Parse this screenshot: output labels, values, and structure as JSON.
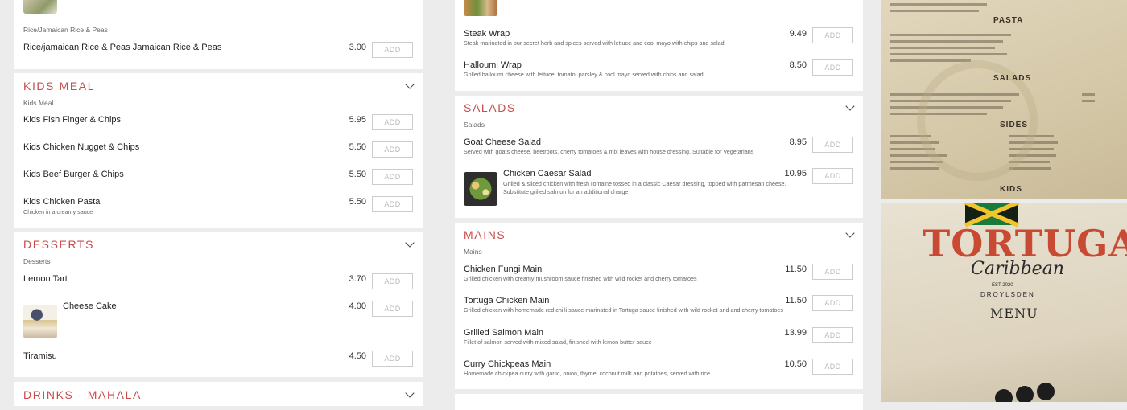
{
  "left": {
    "rice_card": {
      "subtitle": "Rice/Jamaican Rice & Peas",
      "item": {
        "name": "Rice/jamaican Rice & Peas Jamaican Rice & Peas",
        "price": "3.00"
      }
    },
    "kids": {
      "title": "KIDS MEAL",
      "subtitle": "Kids Meal",
      "items": [
        {
          "name": "Kids Fish Finger & Chips",
          "price": "5.95",
          "desc": ""
        },
        {
          "name": "Kids Chicken Nugget & Chips",
          "price": "5.50",
          "desc": ""
        },
        {
          "name": "Kids Beef Burger & Chips",
          "price": "5.50",
          "desc": ""
        },
        {
          "name": "Kids Chicken Pasta",
          "price": "5.50",
          "desc": "Chicken in a creamy sauce"
        }
      ]
    },
    "desserts": {
      "title": "DESSERTS",
      "subtitle": "Desserts",
      "items": [
        {
          "name": "Lemon Tart",
          "price": "3.70"
        },
        {
          "name": "Cheese Cake",
          "price": "4.00"
        },
        {
          "name": "Tiramisu",
          "price": "4.50"
        }
      ]
    },
    "drinks": {
      "title": "DRINKS - MAHALA"
    }
  },
  "mid": {
    "wraps": {
      "items": [
        {
          "name": "Steak Wrap",
          "price": "9.49",
          "desc": "Steak marinated in our secret herb and spices served with lettuce and cool mayo with chips and salad"
        },
        {
          "name": "Halloumi Wrap",
          "price": "8.50",
          "desc": "Grilled halloumi cheese with lettuce, tomato, parsley & cool mayo served with chips and salad"
        }
      ]
    },
    "salads": {
      "title": "SALADS",
      "subtitle": "Salads",
      "items": [
        {
          "name": "Goat Cheese Salad",
          "price": "8.95",
          "desc": "Served with goats cheese, beetroots, cherry tomatoes & mix leaves with house dressing. Suitable for Vegetarians"
        },
        {
          "name": "Chicken Caesar Salad",
          "price": "10.95",
          "desc": "Grilled & sliced chicken with fresh romaine tossed in a classic Caesar dressing, topped with parmesan cheese. Substitute grilled salmon for an additional charge"
        }
      ]
    },
    "mains": {
      "title": "MAINS",
      "subtitle": "Mains",
      "items": [
        {
          "name": "Chicken Fungi Main",
          "price": "11.50",
          "desc": "Grilled chicken with creamy mushroom sauce finished with wild rocket and cherry tomatoes"
        },
        {
          "name": "Tortuga Chicken Main",
          "price": "11.50",
          "desc": "Grilled chicken with homemade red chilli sauce marinated in Tortuga sauce finished with wild rocket and and cherry tomatoes"
        },
        {
          "name": "Grilled Salmon Main",
          "price": "13.99",
          "desc": "Fillet of salmon served with mixed salad, finished with lemon butter sauce"
        },
        {
          "name": "Curry Chickpeas Main",
          "price": "10.50",
          "desc": "Homemade chickpea curry with garlic, onion, thyme, coconut milk and potatoes, served with rice"
        }
      ]
    }
  },
  "add_label": "ADD",
  "menu_photo": {
    "brand": "TORTUGA",
    "script": "Caribbean",
    "est": "EST 2020",
    "location": "DROYLSDEN",
    "menu": "MENU",
    "headings": [
      "PASTA",
      "SALADS",
      "SIDES",
      "KIDS"
    ]
  },
  "colors": {
    "accent": "#c84b4b",
    "background": "#ececec",
    "card": "#ffffff"
  }
}
